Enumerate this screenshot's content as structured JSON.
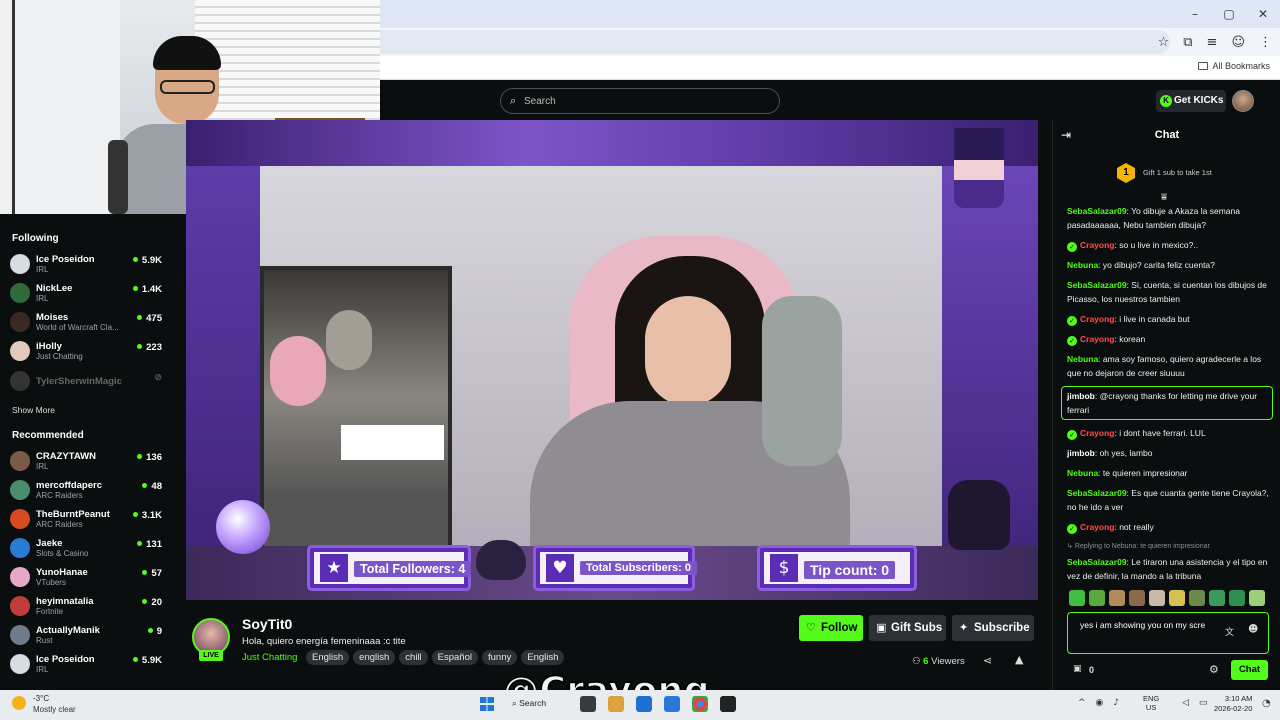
{
  "browser": {
    "window_controls": [
      "–",
      "▢",
      "✕"
    ],
    "bookmarks_label": "All Bookmarks"
  },
  "header": {
    "search_placeholder": "Search",
    "get_kicks_label": "Get KICKs"
  },
  "sidebar": {
    "following_title": "Following",
    "following": [
      {
        "name": "Ice Poseidon",
        "category": "IRL",
        "viewers": "5.9K",
        "color": "#d6dbe4"
      },
      {
        "name": "NickLee",
        "category": "IRL",
        "viewers": "1.4K",
        "color": "#2f6b3a"
      },
      {
        "name": "Moises",
        "category": "World of Warcraft Cla...",
        "viewers": "475",
        "color": "#3b2a22"
      },
      {
        "name": "iHolly",
        "category": "Just Chatting",
        "viewers": "223",
        "color": "#e3c9b9"
      }
    ],
    "offline": {
      "name": "TylerSherwinMagic"
    },
    "show_more_label": "Show More",
    "recommended_title": "Recommended",
    "recommended": [
      {
        "name": "CRAZYTAWN",
        "category": "IRL",
        "viewers": "136",
        "color": "#7b5a47"
      },
      {
        "name": "mercoffdaperc",
        "category": "ARC Raiders",
        "viewers": "48",
        "color": "#4b8c6d"
      },
      {
        "name": "TheBurntPeanut",
        "category": "ARC Raiders",
        "viewers": "3.1K",
        "color": "#d74a1f"
      },
      {
        "name": "Jaeke",
        "category": "Slots & Casino",
        "viewers": "131",
        "color": "#2a7bd6"
      },
      {
        "name": "YunoHanae",
        "category": "VTubers",
        "viewers": "57",
        "color": "#e6a7c9"
      },
      {
        "name": "heyimnatalia",
        "category": "Fortnite",
        "viewers": "20",
        "color": "#c23c3c"
      },
      {
        "name": "ActuallyManik",
        "category": "Rust",
        "viewers": "9",
        "color": "#6d7b8a"
      },
      {
        "name": "Ice Poseidon",
        "category": "IRL",
        "viewers": "5.9K",
        "color": "#d6dbe4"
      }
    ]
  },
  "overlay": {
    "followers_label": "Total Followers: 4",
    "subscribers_label": "Total Subscribers: 0",
    "tips_label": "Tip count: 0"
  },
  "stream": {
    "channel_name": "SoyTit0",
    "title": "Hola, quiero energía femeninaaa :c tite",
    "category": "Just Chatting",
    "tags": [
      "English",
      "english",
      "chill",
      "Español",
      "funny",
      "English"
    ],
    "live_badge": "LIVE",
    "follow_label": "Follow",
    "gift_label": "Gift Subs",
    "subscribe_label": "Subscribe",
    "viewers_count": "6",
    "viewers_label": "Viewers"
  },
  "chat": {
    "title": "Chat",
    "pinned_text": "Gift 1 sub to take 1st",
    "pinned_badge": "1",
    "messages": [
      {
        "user": "SebaSalazar09",
        "color": "#53fc18",
        "text": ": Yo dibuje a Akaza la semana pasadaaaaaa, Nebu tambien dibuja?",
        "badge": false
      },
      {
        "user": "Crayong",
        "color": "#ff4d4d",
        "text": ": so u live in mexico?..",
        "badge": true
      },
      {
        "user": "Nebuna",
        "color": "#53fc18",
        "text": ": yo dibujo? carita feliz cuenta?",
        "badge": false
      },
      {
        "user": "SebaSalazar09",
        "color": "#53fc18",
        "text": ": Si, cuenta, si cuentan los dibujos de Picasso, los nuestros tambien",
        "badge": false
      },
      {
        "user": "Crayong",
        "color": "#ff4d4d",
        "text": ": i live in canada but",
        "badge": true
      },
      {
        "user": "Crayong",
        "color": "#ff4d4d",
        "text": ": korean",
        "badge": true
      },
      {
        "user": "Nebuna",
        "color": "#53fc18",
        "text": ": ama soy famoso, quiero agradecerle a los que no dejaron de creer siuuuu",
        "badge": false
      },
      {
        "user": "jimbob",
        "color": "#ffffff",
        "text": ": @crayong thanks for letting me drive your ferrari",
        "badge": false,
        "highlight": true
      },
      {
        "user": "Crayong",
        "color": "#ff4d4d",
        "text": ": i dont have ferrari. LUL",
        "badge": true
      },
      {
        "user": "jimbob",
        "color": "#ffffff",
        "text": ": oh yes, lambo",
        "badge": false
      },
      {
        "user": "Nebuna",
        "color": "#53fc18",
        "text": ": te quieren impresionar",
        "badge": false
      },
      {
        "user": "SebaSalazar09",
        "color": "#53fc18",
        "text": ": Es que cuanta gente tiene Crayola?, no he ido a ver",
        "badge": false
      },
      {
        "user": "Crayong",
        "color": "#ff4d4d",
        "text": ": not really",
        "badge": true
      },
      {
        "user": "SebaSalazar09",
        "color": "#53fc18",
        "text": ": Le tiraron una asistencia y el tipo en vez de definir, la mando a la tribuna",
        "badge": false,
        "reply": "Replying to Nebuna: te quieren impresionar"
      }
    ],
    "input_value": "yes i am showing you on my scre",
    "gift_count": "0",
    "send_label": "Chat"
  },
  "watermark": "@Crayong",
  "taskbar": {
    "temperature": "-3°C",
    "condition": "Mostly clear",
    "search_label": "Search",
    "lang_top": "ENG",
    "lang_bottom": "US",
    "time": "3:10 AM",
    "date": "2026-02-20"
  }
}
